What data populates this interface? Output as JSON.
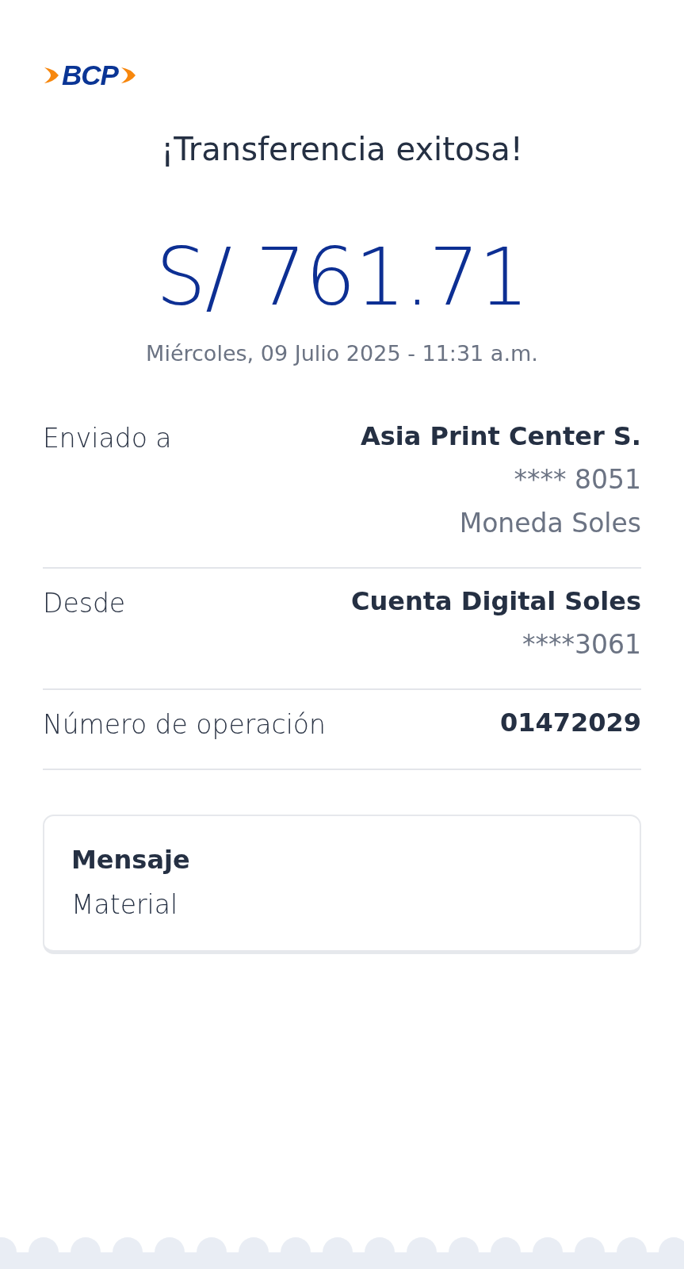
{
  "logo": {
    "text": "BCP"
  },
  "title": "¡Transferencia exitosa!",
  "amount": "S/ 761.71",
  "datetime": "Miércoles, 09 Julio 2025 - 11:31 a.m.",
  "details": [
    {
      "label": "Enviado a",
      "lines": [
        "Asia Print Center S.",
        "**** 8051",
        "Moneda Soles"
      ]
    },
    {
      "label": "Desde",
      "lines": [
        "Cuenta Digital Soles",
        "****3061"
      ]
    },
    {
      "label": "Número de operación",
      "lines": [
        "01472029"
      ]
    }
  ],
  "message": {
    "label": "Mensaje",
    "text": "Material"
  }
}
